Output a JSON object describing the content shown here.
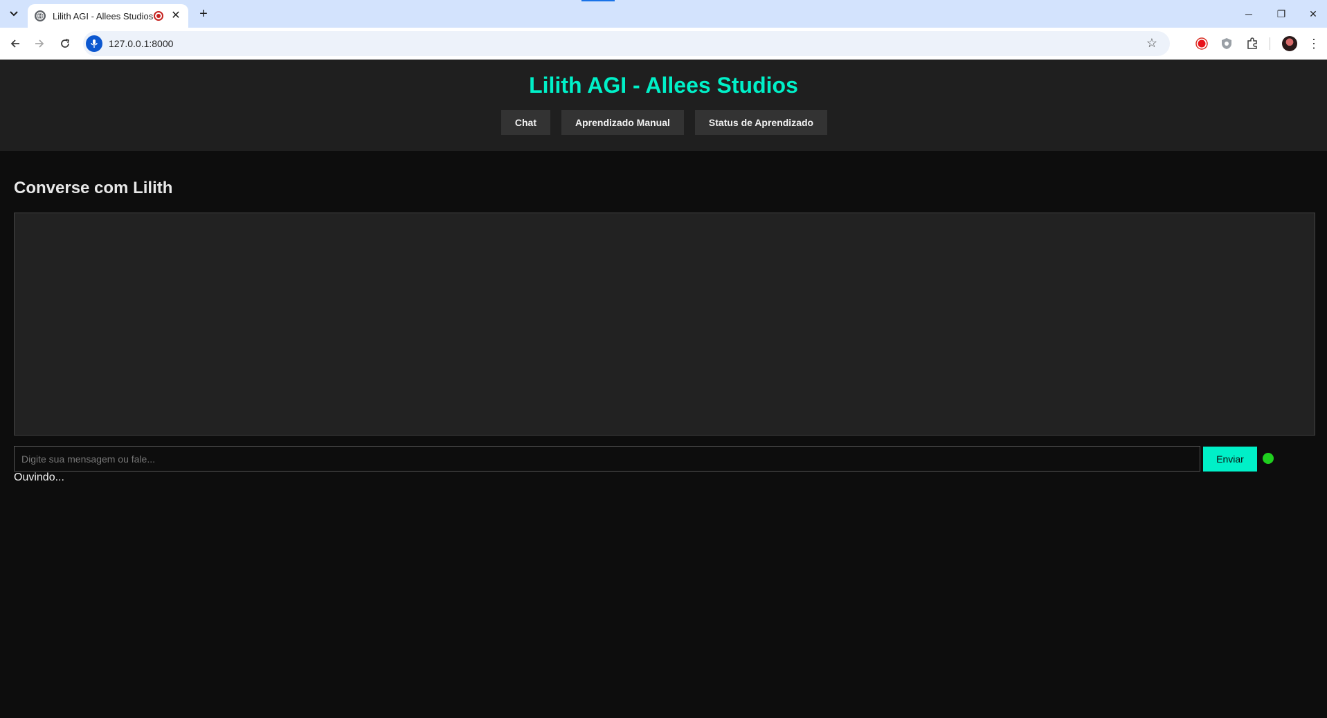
{
  "browser": {
    "tab_title": "Lilith AGI - Allees Studios",
    "new_tab_symbol": "+",
    "close_symbol": "✕",
    "url": "127.0.0.1:8000",
    "window_controls": {
      "minimize": "─",
      "restore": "❐",
      "close": "✕"
    },
    "icons": [
      "tab-search-icon",
      "globe-icon",
      "record-icon",
      "back-icon",
      "forward-icon",
      "reload-icon",
      "mic-icon",
      "star-icon",
      "recording-extension-icon",
      "shield-extension-icon",
      "puzzle-extensions-icon",
      "profile-avatar",
      "more-menu-icon"
    ]
  },
  "page": {
    "title": "Lilith AGI - Allees Studios",
    "nav": {
      "chat": "Chat",
      "manual_learning": "Aprendizado Manual",
      "learning_status": "Status de Aprendizado"
    },
    "section_title": "Converse com Lilith",
    "input_placeholder": "Digite sua mensagem ou fale...",
    "send_label": "Enviar",
    "status_text": "Ouvindo...",
    "colors": {
      "accent": "#00f0c8",
      "listening_indicator": "#1fcf1f",
      "background": "#0d0d0d",
      "header": "#1f1f1f",
      "chat_area": "#222222"
    }
  }
}
